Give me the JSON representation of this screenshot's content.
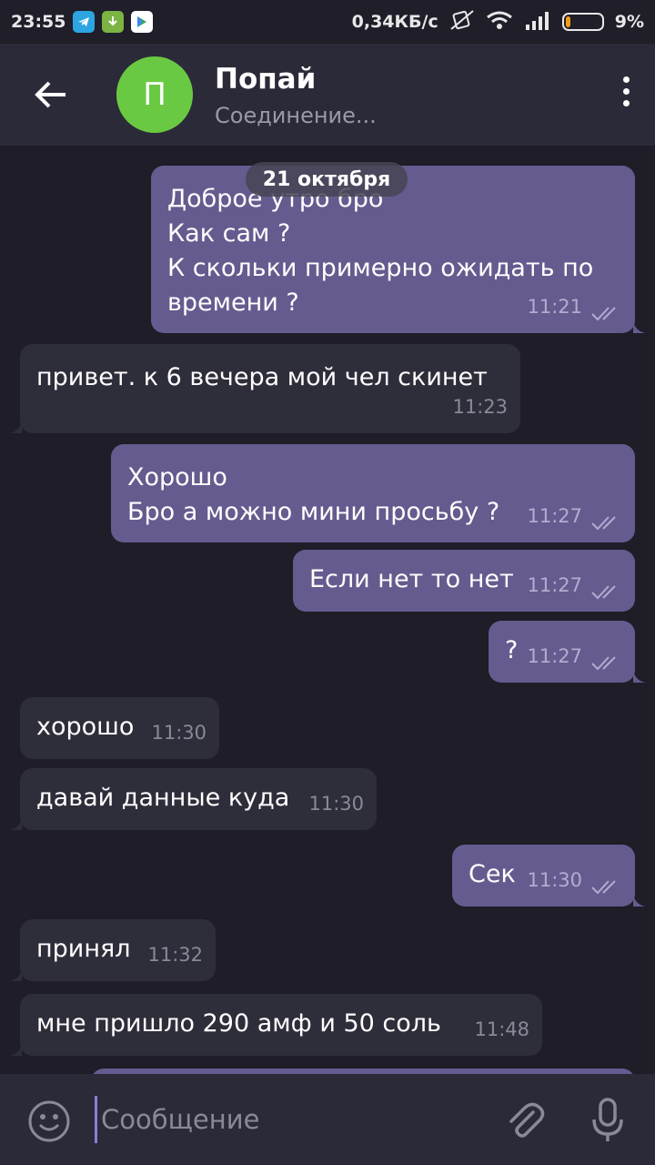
{
  "status_bar": {
    "time": "23:55",
    "network_speed": "0,34КБ/с",
    "battery_percent": "9%",
    "battery_level": 0.09,
    "icons": [
      "telegram-icon",
      "download-icon",
      "play-store-icon",
      "silent-icon",
      "wifi-icon",
      "signal-icon",
      "battery-icon"
    ]
  },
  "header": {
    "contact_name": "Попай",
    "status": "Соединение...",
    "avatar_letter": "П",
    "avatar_color": "#6ac943"
  },
  "chat": {
    "date_label": "21 октября",
    "messages": [
      {
        "direction": "out",
        "lines": [
          "Доброе утро бро",
          "Как сам ?",
          "К скольки примерно ожидать по",
          "времени ?"
        ],
        "time": "11:21"
      },
      {
        "direction": "in",
        "text": "привет. к 6 вечера мой чел скинет",
        "time": "11:23"
      },
      {
        "direction": "out",
        "lines": [
          "Хорошо",
          "Бро а можно мини просьбу ?"
        ],
        "time": "11:27"
      },
      {
        "direction": "out",
        "text": "Если нет то нет",
        "time": "11:27"
      },
      {
        "direction": "out",
        "text": "?",
        "time": "11:27"
      },
      {
        "direction": "in",
        "text": "хорошо",
        "time": "11:30"
      },
      {
        "direction": "in",
        "text": "давай данные куда",
        "time": "11:30"
      },
      {
        "direction": "out",
        "text": "Сек",
        "time": "11:30"
      },
      {
        "direction": "in",
        "text": "принял",
        "time": "11:32"
      },
      {
        "direction": "in",
        "text": "мне пришло 290 амф и 50 соль",
        "time": "11:48"
      }
    ]
  },
  "input": {
    "placeholder": "Сообщение"
  },
  "colors": {
    "outgoing_bubble": "#665b8e",
    "incoming_bubble": "#2e2d3a",
    "background": "#1e1d28",
    "header": "#2b2a38"
  }
}
